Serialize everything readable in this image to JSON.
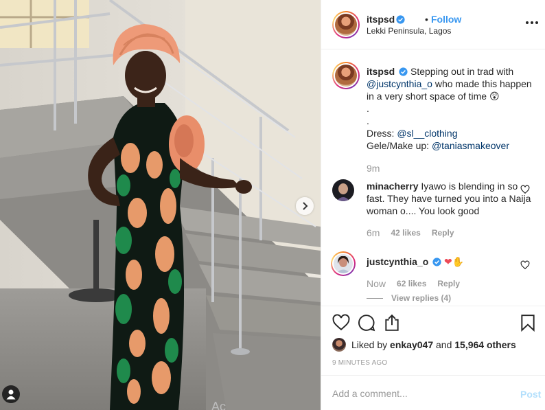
{
  "post": {
    "author": "itspsd",
    "follow_dot": "•",
    "follow_label": "Follow",
    "location": "Lekki Peninsula, Lagos"
  },
  "caption": {
    "username": "itspsd",
    "text_1": "Stepping out in trad with",
    "mention_1": "@justcynthia_o",
    "text_2": "who made this happen in a very short space of time 😲",
    "dot_1": ".",
    "dot_2": ".",
    "dress_label": "Dress:",
    "dress_mention": "@sl__clothing",
    "gele_label": "Gele/Make up:",
    "gele_mention": "@taniasmakeover",
    "time": "9m"
  },
  "comments": [
    {
      "username": "minacherry",
      "text": "Iyawo is blending in so fast. They have turned you into a Naija woman o.... You look good",
      "time": "6m",
      "likes": "42 likes",
      "reply": "Reply"
    },
    {
      "username": "justcynthia_o",
      "text": "❤✋",
      "time": "Now",
      "likes": "62 likes",
      "reply": "Reply",
      "view_replies": "View replies (4)"
    }
  ],
  "liked_by": {
    "prefix": "Liked by",
    "user": "enkay047",
    "and": "and",
    "others": "15,964 others"
  },
  "timestamp": "9 MINUTES AGO",
  "comment_box": {
    "placeholder": "Add a comment...",
    "post_label": "Post"
  },
  "watermark": "Ac",
  "colors": {
    "link_blue": "#3897f0",
    "mention_blue": "#003569",
    "muted": "#999999",
    "post_disabled": "#b2dffc",
    "heart_red": "#ed4956"
  },
  "icons": [
    "verified-badge-icon",
    "more-options-icon",
    "heart-icon",
    "comment-icon",
    "share-icon",
    "bookmark-icon",
    "next-arrow-icon",
    "user-tag-icon"
  ]
}
